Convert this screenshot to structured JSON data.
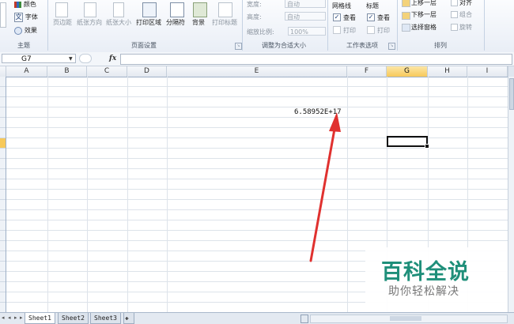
{
  "ribbon": {
    "theme_group": {
      "colors": "颜色",
      "fonts": "字体",
      "effects": "效果",
      "title": "主题",
      "font_glyph": "文"
    },
    "page_setup": {
      "buttons": [
        "页边距",
        "纸张方向",
        "纸张大小",
        "打印区域",
        "分隔符",
        "背景",
        "打印标题"
      ],
      "title": "页面设置"
    },
    "scale_to_fit": {
      "width_label": "宽度:",
      "width_value": "自动",
      "height_label": "高度:",
      "height_value": "自动",
      "scale_label": "缩放比例:",
      "scale_value": "100%",
      "title": "调整为合适大小"
    },
    "sheet_options": {
      "gridlines": "网格线",
      "headings": "标题",
      "view": "查看",
      "print": "打印",
      "gridlines_view_checked": true,
      "gridlines_print_checked": false,
      "headings_view_checked": true,
      "headings_print_checked": false,
      "title": "工作表选项"
    },
    "arrange": {
      "bring_forward": "上移一层",
      "send_backward": "下移一层",
      "selection_pane": "选择窗格",
      "align": "对齐",
      "group": "组合",
      "rotate": "旋转",
      "title": "排列"
    }
  },
  "formula_bar": {
    "name_box": "G7",
    "fx": "fx",
    "content": ""
  },
  "columns": [
    "A",
    "B",
    "C",
    "D",
    "E",
    "F",
    "G",
    "H",
    "I"
  ],
  "selected_column": "G",
  "cell_value": "6.58952E+17",
  "sheets": [
    "Sheet1",
    "Sheet2",
    "Sheet3"
  ],
  "active_sheet": "Sheet1",
  "watermark": {
    "title": "百科全说",
    "subtitle": "助你轻松解决"
  },
  "colors": {
    "arrow": "#e0312f",
    "watermark": "#1f8f7a",
    "selection_header": "#f7c95a"
  }
}
